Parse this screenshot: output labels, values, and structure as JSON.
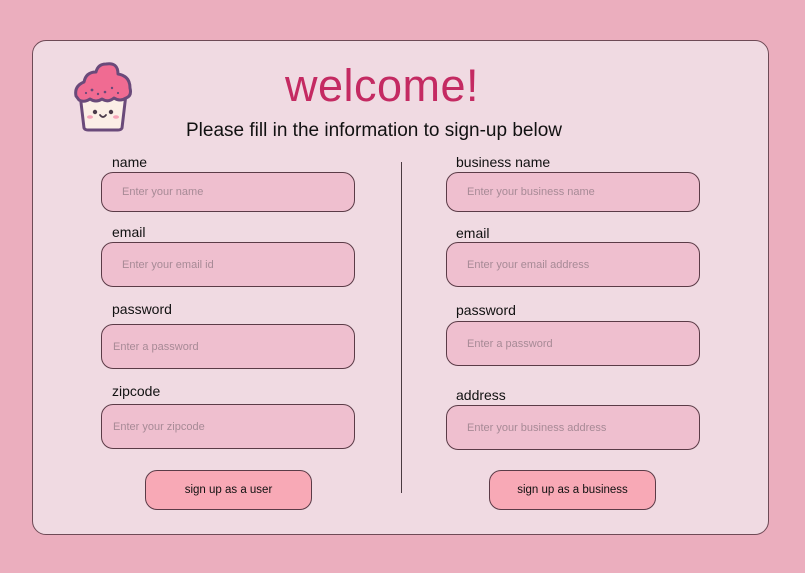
{
  "header": {
    "title": "welcome!",
    "subtitle": "Please fill in the information to sign-up below",
    "logo_icon": "cupcake-icon"
  },
  "user_form": {
    "name_label": "name",
    "name_placeholder": "Enter your name",
    "email_label": "email",
    "email_placeholder": "Enter your email id",
    "password_label": "password",
    "password_placeholder": "Enter a password",
    "zipcode_label": "zipcode",
    "zipcode_placeholder": "Enter your zipcode",
    "submit_label": "sign up as a user"
  },
  "business_form": {
    "name_label": "business name",
    "name_placeholder": "Enter your business name",
    "email_label": "email",
    "email_placeholder": "Enter your email address",
    "password_label": "password",
    "password_placeholder": "Enter a password",
    "address_label": "address",
    "address_placeholder": "Enter your business address",
    "submit_label": "sign up as a business"
  },
  "colors": {
    "page_background": "#ebaebe",
    "card_background": "#f0dae2",
    "title": "#c42a62",
    "input_fill": "#efbfcf",
    "button_fill": "#f8a9b6"
  }
}
